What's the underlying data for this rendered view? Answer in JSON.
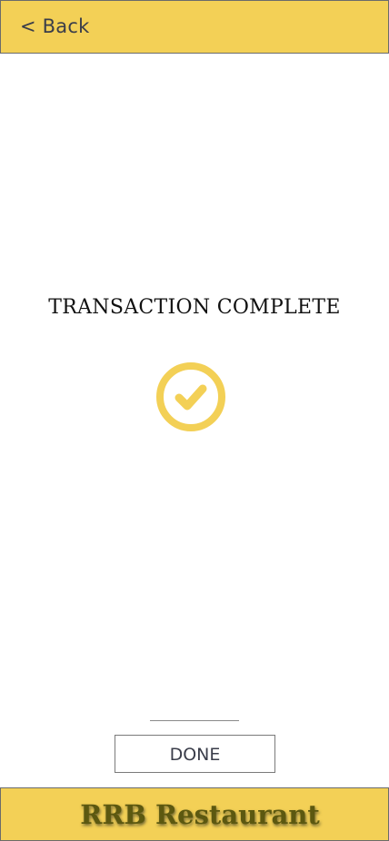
{
  "header": {
    "back_label": "< Back"
  },
  "main": {
    "status_title": "TRANSACTION COMPLETE",
    "status_icon": "check-circle-icon"
  },
  "actions": {
    "done_label": "DONE"
  },
  "footer": {
    "brand_name": "RRB Restaurant"
  },
  "colors": {
    "accent": "#f3d056",
    "brand_text": "#5c5810",
    "icon": "#f3d056"
  }
}
